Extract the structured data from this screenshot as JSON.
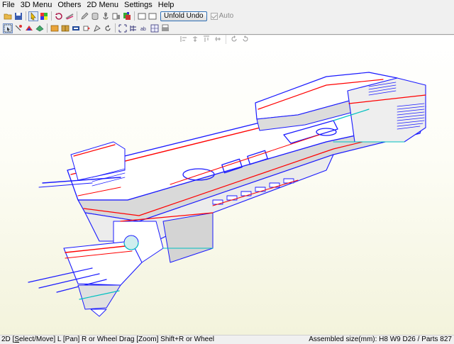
{
  "menu": {
    "items": [
      {
        "label": "File"
      },
      {
        "label": "3D Menu"
      },
      {
        "label": "Others"
      },
      {
        "label": "2D Menu"
      },
      {
        "label": "Settings"
      },
      {
        "label": "Help"
      }
    ]
  },
  "toolbar1": {
    "icons": [
      "open-folder-icon",
      "save-icon",
      "select-3d-icon",
      "color-cube-icon",
      "rotate-icon",
      "shear-icon",
      "pencil-icon",
      "cylinder-icon",
      "anchor-icon",
      "part-view-icon",
      "color-view-icon",
      "window-a-icon",
      "window-b-icon"
    ],
    "unfold_undo_label": "Unfold Undo",
    "auto_label": "Auto"
  },
  "toolbar2": {
    "icons": [
      "select-arrow-icon",
      "join-icon",
      "paint-icon",
      "fold-icon",
      "tab-icon",
      "book-icon",
      "flag-icon",
      "tab-flip-icon",
      "edge-icon",
      "rotate-part-icon",
      "align-icon",
      "number-icon",
      "text-icon",
      "grid-icon",
      "print-icon"
    ],
    "align_icons": [
      "align-left-icon",
      "align-center-icon",
      "align-top-icon",
      "align-middle-icon",
      "rotate-left-icon",
      "rotate-right-icon"
    ]
  },
  "viewport": {
    "model": "3D wireframe starship model",
    "colors": {
      "edge": "#0000ff",
      "fold": "#ff0000",
      "face": "#ffffff",
      "shade": "#d7d7d7",
      "cyan": "#00c0c0"
    }
  },
  "status": {
    "left_prefix": "2D [",
    "left_select": "S",
    "left_rest": "elect/Move] L [Pan] R or Wheel Drag [Zoom] Shift+R or Wheel",
    "right": "Assembled size(mm): H8 W9 D26 / Parts 827"
  }
}
